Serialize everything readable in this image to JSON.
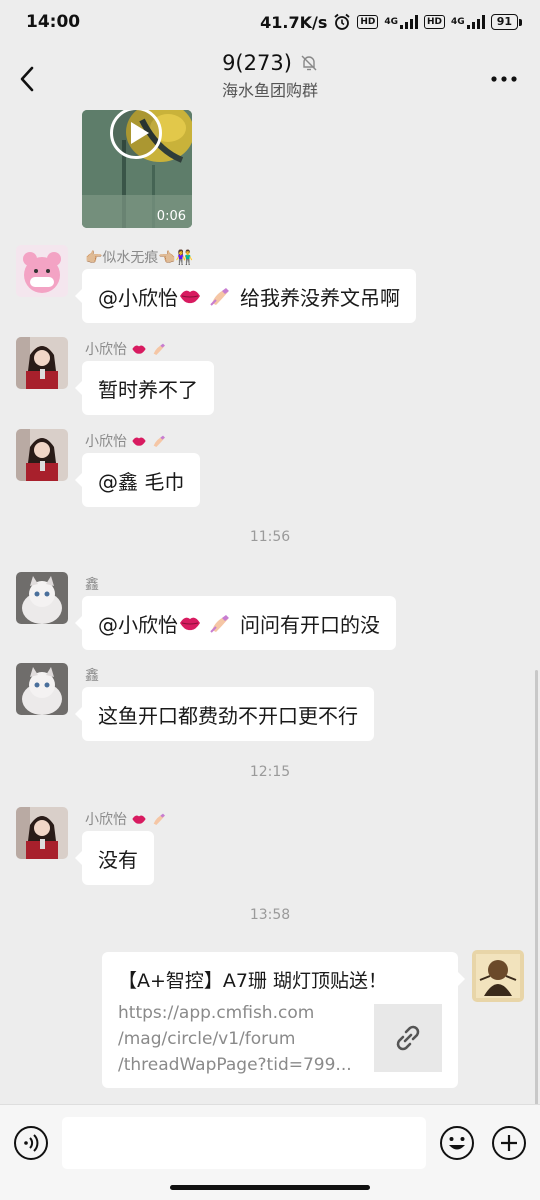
{
  "status_bar": {
    "time": "14:00",
    "speed": "41.7K/s",
    "net1": "4G",
    "net2": "4G",
    "battery": "91"
  },
  "header": {
    "title": "9(273)",
    "subtitle": "海水鱼团购群",
    "more": "···"
  },
  "video": {
    "duration": "0:06"
  },
  "messages": [
    {
      "sender": "👉🏼似水无痕👈🏼👫",
      "text_pre": "@小欣怡",
      "text_post": "给我养没养文吊啊"
    },
    {
      "sender": "小欣怡",
      "text": "暂时养不了"
    },
    {
      "sender": "小欣怡",
      "text": "@鑫  毛巾"
    },
    {
      "sender": "鑫",
      "text_pre": "@小欣怡",
      "text_post": "问问有开口的没"
    },
    {
      "sender": "鑫",
      "text": "这鱼开口都费劲不开口更不行"
    },
    {
      "sender": "小欣怡",
      "text": "没有"
    }
  ],
  "timestamps": [
    "11:56",
    "12:15",
    "13:58"
  ],
  "link_card": {
    "title": "【A+智控】A7珊 瑚灯顶贴送！",
    "desc_lines": [
      "https://app.cmfish.com",
      "/mag/circle/v1/forum",
      "/threadWapPage?tid=799..."
    ]
  },
  "input": {
    "placeholder": ""
  },
  "colors": {
    "background": "#ededed",
    "bubble": "#ffffff",
    "link_icon": "#555555"
  },
  "icons": [
    "back-icon",
    "more-icon",
    "mute-bell-icon",
    "play-icon",
    "link-icon",
    "voice-icon",
    "emoji-icon",
    "plus-icon"
  ]
}
